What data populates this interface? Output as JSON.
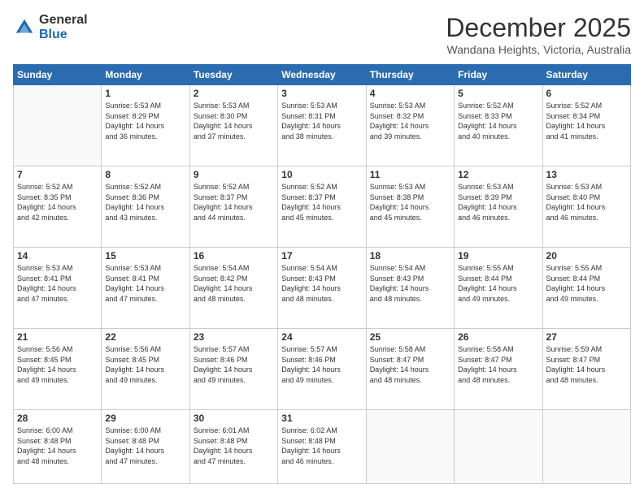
{
  "header": {
    "logo_general": "General",
    "logo_blue": "Blue",
    "month": "December 2025",
    "location": "Wandana Heights, Victoria, Australia"
  },
  "weekdays": [
    "Sunday",
    "Monday",
    "Tuesday",
    "Wednesday",
    "Thursday",
    "Friday",
    "Saturday"
  ],
  "weeks": [
    [
      {
        "day": "",
        "info": ""
      },
      {
        "day": "1",
        "info": "Sunrise: 5:53 AM\nSunset: 8:29 PM\nDaylight: 14 hours\nand 36 minutes."
      },
      {
        "day": "2",
        "info": "Sunrise: 5:53 AM\nSunset: 8:30 PM\nDaylight: 14 hours\nand 37 minutes."
      },
      {
        "day": "3",
        "info": "Sunrise: 5:53 AM\nSunset: 8:31 PM\nDaylight: 14 hours\nand 38 minutes."
      },
      {
        "day": "4",
        "info": "Sunrise: 5:53 AM\nSunset: 8:32 PM\nDaylight: 14 hours\nand 39 minutes."
      },
      {
        "day": "5",
        "info": "Sunrise: 5:52 AM\nSunset: 8:33 PM\nDaylight: 14 hours\nand 40 minutes."
      },
      {
        "day": "6",
        "info": "Sunrise: 5:52 AM\nSunset: 8:34 PM\nDaylight: 14 hours\nand 41 minutes."
      }
    ],
    [
      {
        "day": "7",
        "info": "Sunrise: 5:52 AM\nSunset: 8:35 PM\nDaylight: 14 hours\nand 42 minutes."
      },
      {
        "day": "8",
        "info": "Sunrise: 5:52 AM\nSunset: 8:36 PM\nDaylight: 14 hours\nand 43 minutes."
      },
      {
        "day": "9",
        "info": "Sunrise: 5:52 AM\nSunset: 8:37 PM\nDaylight: 14 hours\nand 44 minutes."
      },
      {
        "day": "10",
        "info": "Sunrise: 5:52 AM\nSunset: 8:37 PM\nDaylight: 14 hours\nand 45 minutes."
      },
      {
        "day": "11",
        "info": "Sunrise: 5:53 AM\nSunset: 8:38 PM\nDaylight: 14 hours\nand 45 minutes."
      },
      {
        "day": "12",
        "info": "Sunrise: 5:53 AM\nSunset: 8:39 PM\nDaylight: 14 hours\nand 46 minutes."
      },
      {
        "day": "13",
        "info": "Sunrise: 5:53 AM\nSunset: 8:40 PM\nDaylight: 14 hours\nand 46 minutes."
      }
    ],
    [
      {
        "day": "14",
        "info": "Sunrise: 5:53 AM\nSunset: 8:41 PM\nDaylight: 14 hours\nand 47 minutes."
      },
      {
        "day": "15",
        "info": "Sunrise: 5:53 AM\nSunset: 8:41 PM\nDaylight: 14 hours\nand 47 minutes."
      },
      {
        "day": "16",
        "info": "Sunrise: 5:54 AM\nSunset: 8:42 PM\nDaylight: 14 hours\nand 48 minutes."
      },
      {
        "day": "17",
        "info": "Sunrise: 5:54 AM\nSunset: 8:43 PM\nDaylight: 14 hours\nand 48 minutes."
      },
      {
        "day": "18",
        "info": "Sunrise: 5:54 AM\nSunset: 8:43 PM\nDaylight: 14 hours\nand 48 minutes."
      },
      {
        "day": "19",
        "info": "Sunrise: 5:55 AM\nSunset: 8:44 PM\nDaylight: 14 hours\nand 49 minutes."
      },
      {
        "day": "20",
        "info": "Sunrise: 5:55 AM\nSunset: 8:44 PM\nDaylight: 14 hours\nand 49 minutes."
      }
    ],
    [
      {
        "day": "21",
        "info": "Sunrise: 5:56 AM\nSunset: 8:45 PM\nDaylight: 14 hours\nand 49 minutes."
      },
      {
        "day": "22",
        "info": "Sunrise: 5:56 AM\nSunset: 8:45 PM\nDaylight: 14 hours\nand 49 minutes."
      },
      {
        "day": "23",
        "info": "Sunrise: 5:57 AM\nSunset: 8:46 PM\nDaylight: 14 hours\nand 49 minutes."
      },
      {
        "day": "24",
        "info": "Sunrise: 5:57 AM\nSunset: 8:46 PM\nDaylight: 14 hours\nand 49 minutes."
      },
      {
        "day": "25",
        "info": "Sunrise: 5:58 AM\nSunset: 8:47 PM\nDaylight: 14 hours\nand 48 minutes."
      },
      {
        "day": "26",
        "info": "Sunrise: 5:58 AM\nSunset: 8:47 PM\nDaylight: 14 hours\nand 48 minutes."
      },
      {
        "day": "27",
        "info": "Sunrise: 5:59 AM\nSunset: 8:47 PM\nDaylight: 14 hours\nand 48 minutes."
      }
    ],
    [
      {
        "day": "28",
        "info": "Sunrise: 6:00 AM\nSunset: 8:48 PM\nDaylight: 14 hours\nand 48 minutes."
      },
      {
        "day": "29",
        "info": "Sunrise: 6:00 AM\nSunset: 8:48 PM\nDaylight: 14 hours\nand 47 minutes."
      },
      {
        "day": "30",
        "info": "Sunrise: 6:01 AM\nSunset: 8:48 PM\nDaylight: 14 hours\nand 47 minutes."
      },
      {
        "day": "31",
        "info": "Sunrise: 6:02 AM\nSunset: 8:48 PM\nDaylight: 14 hours\nand 46 minutes."
      },
      {
        "day": "",
        "info": ""
      },
      {
        "day": "",
        "info": ""
      },
      {
        "day": "",
        "info": ""
      }
    ]
  ]
}
